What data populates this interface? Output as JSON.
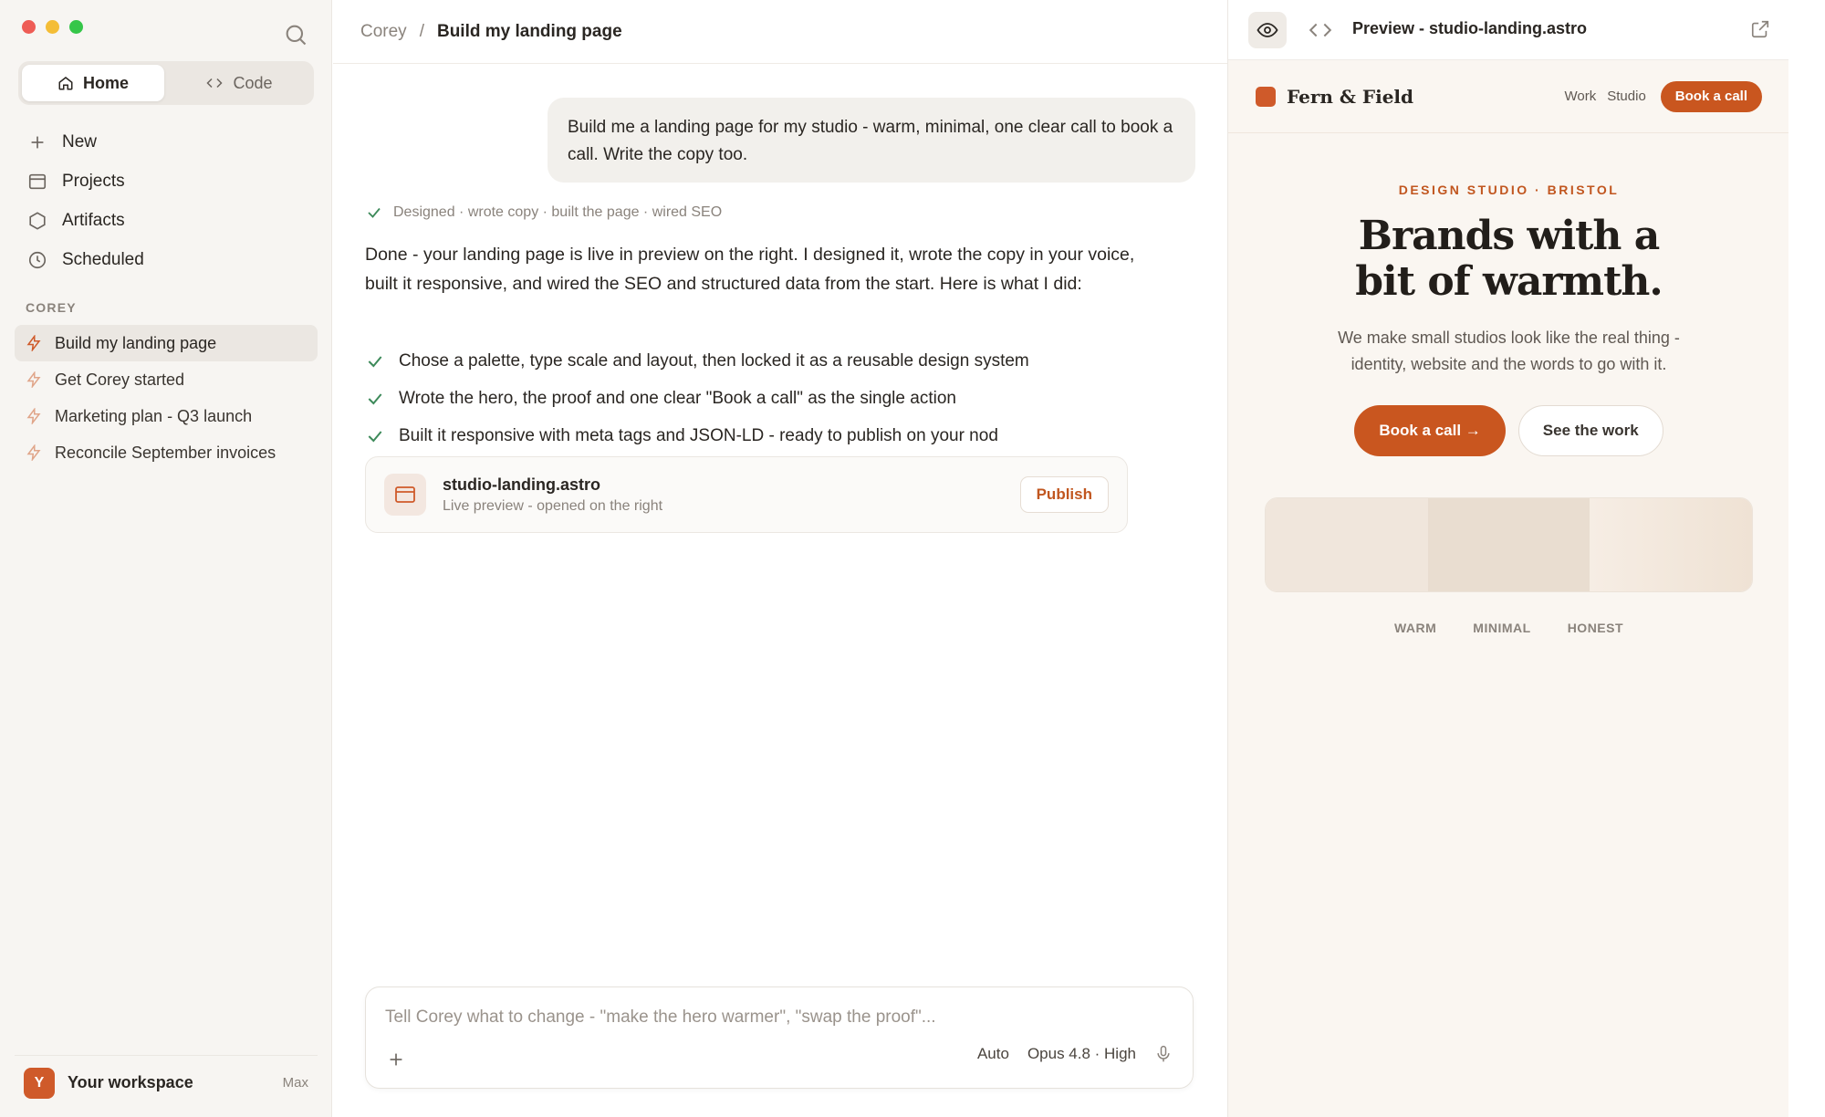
{
  "sidebar": {
    "tabs": [
      {
        "label": "Home",
        "icon": "home-icon"
      },
      {
        "label": "Code",
        "icon": "code-icon"
      }
    ],
    "nav": [
      {
        "label": "New",
        "icon": "plus-icon"
      },
      {
        "label": "Projects",
        "icon": "folder-icon"
      },
      {
        "label": "Artifacts",
        "icon": "hexagon-icon"
      },
      {
        "label": "Scheduled",
        "icon": "clock-icon"
      }
    ],
    "section_label": "COREY",
    "conversations": [
      "Build my landing page",
      "Get Corey started",
      "Marketing plan - Q3 launch",
      "Reconcile September invoices"
    ],
    "workspace": {
      "avatar": "Y",
      "name": "Your workspace",
      "plan": "Max"
    }
  },
  "breadcrumb": {
    "parent": "Corey",
    "separator": "/",
    "current": "Build my landing page"
  },
  "chat": {
    "user_message": "Build me a landing page for my studio - warm, minimal, one clear call to book a call. Write the copy too.",
    "status": "Designed · wrote copy · built the page · wired SEO",
    "reply": "Done - your landing page is live in preview on the right. I designed it, wrote the copy in your voice, built it responsive, and wired the SEO and structured data from the start. Here is what I did:",
    "checklist": [
      "Chose a palette, type scale and layout, then locked it as a reusable design system",
      "Wrote the hero, the proof and one clear \"Book a call\" as the single action",
      "Built it responsive with meta tags and JSON-LD - ready to publish on your nod"
    ],
    "artifact": {
      "name": "studio-landing.astro",
      "subtitle": "Live preview - opened on the right",
      "action": "Publish"
    }
  },
  "composer": {
    "placeholder": "Tell Corey what to change - \"make the hero warmer\", \"swap the proof\"...",
    "mode": "Auto",
    "model": "Opus 4.8 · High"
  },
  "preview": {
    "title": "Preview - studio-landing.astro",
    "site": {
      "brand": "Fern & Field",
      "links": [
        "Work",
        "Studio"
      ],
      "nav_cta": "Book a call",
      "eyebrow": "DESIGN STUDIO · BRISTOL",
      "headline_line1": "Brands with a",
      "headline_line2": "bit of warmth.",
      "subhead": "We make small studios look like the real thing - identity, website and the words to go with it.",
      "primary_cta": "Book a call →",
      "secondary_cta": "See the work",
      "values": [
        "WARM",
        "MINIMAL",
        "HONEST"
      ]
    }
  },
  "colors": {
    "accent": "#c9561f",
    "sidebar_bg": "#f7f5f2",
    "preview_bg": "#faf6f1",
    "check_green": "#3d8a5a"
  }
}
